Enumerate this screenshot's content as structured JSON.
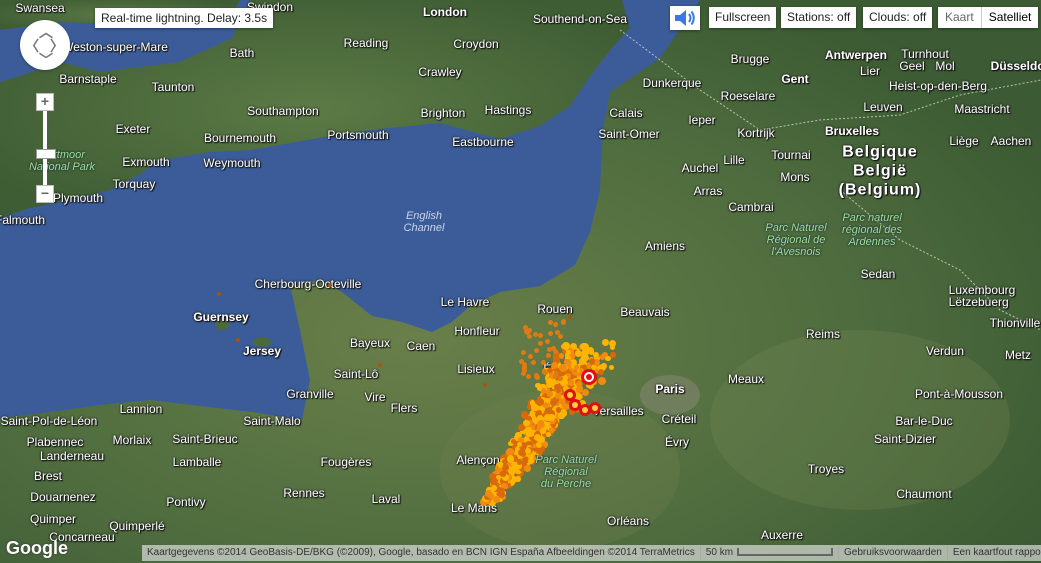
{
  "controls": {
    "status": "Real-time lightning. Delay: 3.5s",
    "sound_icon": "speaker-icon",
    "fullscreen": "Fullscreen",
    "stations": "Stations: off",
    "clouds": "Clouds: off",
    "map_type": {
      "map": "Kaart",
      "satellite": "Satelliet",
      "selected": "Satelliet"
    },
    "zoom_in": "+",
    "zoom_out": "−",
    "zoom_level_fraction": 0.5
  },
  "footer": {
    "logo": "Google",
    "attribution": "Kaartgegevens ©2014 GeoBasis-DE/BKG (©2009), Google, basado en BCN IGN España Afbeeldingen ©2014 TerraMetrics",
    "scale": "50 km",
    "terms": "Gebruiksvoorwaarden",
    "report": "Een kaartfout rapporteren"
  },
  "colors": {
    "sea": "#3b5c98",
    "land": "#4b6a3c",
    "lightning_old": "#c0640a",
    "lightning_new": "#ffc000",
    "lightning_latest": "#e01010"
  },
  "labels": [
    "Swansea",
    "Swindon",
    "London",
    "Southend-on-Sea",
    "Weston-super-Mare",
    "Bath",
    "Reading",
    "Croydon",
    "Barnstaple",
    "Taunton",
    "Crawley",
    "Dunkerque",
    "Brugge",
    "Gent",
    "Antwerpen",
    "Turnhout",
    "Lier",
    "Geel",
    "Mol",
    "Düsseldorf",
    "Heist-op-den-Berg",
    "Roeselare",
    "Leuven",
    "Maastricht",
    "Southampton",
    "Portsmouth",
    "Brighton",
    "Hastings",
    "Calais",
    "Ieper",
    "Kortrijk",
    "Bruxelles",
    "Liège",
    "Aachen",
    "Exeter",
    "Bournemouth",
    "Eastbourne",
    "Saint-Omer",
    "Lille",
    "Tournai",
    "Exmouth",
    "Weymouth",
    "Auchel",
    "Mons",
    "Torquay",
    "Arras",
    "Plymouth",
    "Cambrai",
    "Falmouth",
    "Amiens",
    "Sedan",
    "Cherbourg-Octeville",
    "Le Havre",
    "Rouen",
    "Beauvais",
    "Guernsey",
    "Honfleur",
    "Reims",
    "Thionville",
    "Bayeux",
    "Caen",
    "Jersey",
    "Verdun",
    "Metz",
    "Lisieux",
    "Évreux",
    "Saint-Lô",
    "Paris",
    "Meaux",
    "Vire",
    "Flers",
    "Granville",
    "Pont-à-Mousson",
    "Versailles",
    "Créteil",
    "Lannion",
    "Saint-Malo",
    "Saint-Pol-de-Léon",
    "Bar-le-Duc",
    "Évry",
    "Plabennec",
    "Morlaix",
    "Saint-Brieuc",
    "Saint-Dizier",
    "Landerneau",
    "Lamballe",
    "Fougères",
    "Alençon",
    "Troyes",
    "Brest",
    "Douarnenez",
    "Pontivy",
    "Rennes",
    "Laval",
    "Chaumont",
    "Le Mans",
    "Quimper",
    "Quimperlé",
    "Concarneau",
    "Orléans",
    "Auxerre"
  ],
  "big_labels": {
    "belgium": "Belgique\nBelgië\n(Belgium)",
    "luxembourg": "Luxembourg\nLëtzebuerg"
  },
  "park_labels": [
    "Dartmoor\nNational Park",
    "Parc naturel\nrégional des\nArdennes",
    "Parc Naturel\nRégional de\nl'Avesnois",
    "Parc Naturel\nRégional\ndu Perche"
  ],
  "sea_labels": [
    "English\nChannel"
  ]
}
